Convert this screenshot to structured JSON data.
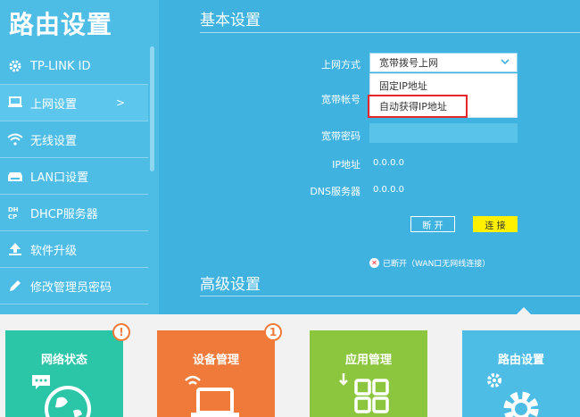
{
  "sidebar": {
    "title": "路由设置",
    "items": [
      {
        "label": "TP-LINK ID",
        "icon": "gear-icon"
      },
      {
        "label": "上网设置",
        "icon": "monitor-icon",
        "chevron": ">"
      },
      {
        "label": "无线设置",
        "icon": "wifi-icon"
      },
      {
        "label": "LAN口设置",
        "icon": "lan-icon"
      },
      {
        "label": "DHCP服务器",
        "icon": "dhcp-icon"
      },
      {
        "label": "软件升级",
        "icon": "upload-icon"
      },
      {
        "label": "修改管理员密码",
        "icon": "pencil-icon"
      }
    ]
  },
  "main": {
    "basic_title": "基本设置",
    "advanced_title": "高级设置",
    "form": {
      "mode_label": "上网方式",
      "mode_value": "宽带拨号上网",
      "mode_options": [
        "固定IP地址",
        "自动获得IP地址"
      ],
      "account_label": "宽带帐号",
      "password_label": "宽带密码",
      "ip_label": "IP地址",
      "ip_value": "0.0.0.0",
      "dns_label": "DNS服务器",
      "dns_value": "0.0.0.0"
    },
    "buttons": {
      "disconnect": "断 开",
      "connect": "连 接"
    },
    "status": "已断开（WAN口无网线连接）"
  },
  "tiles": [
    {
      "label": "网络状态",
      "color": "#2bc6a8",
      "badge": "!"
    },
    {
      "label": "设备管理",
      "color": "#f07a3a",
      "badge": "1"
    },
    {
      "label": "应用管理",
      "color": "#8cc63f"
    },
    {
      "label": "路由设置",
      "color": "#4dbde6"
    }
  ],
  "colors": {
    "accent": "#4dbde6",
    "highlight": "#e6262d",
    "connect": "#fff000"
  }
}
